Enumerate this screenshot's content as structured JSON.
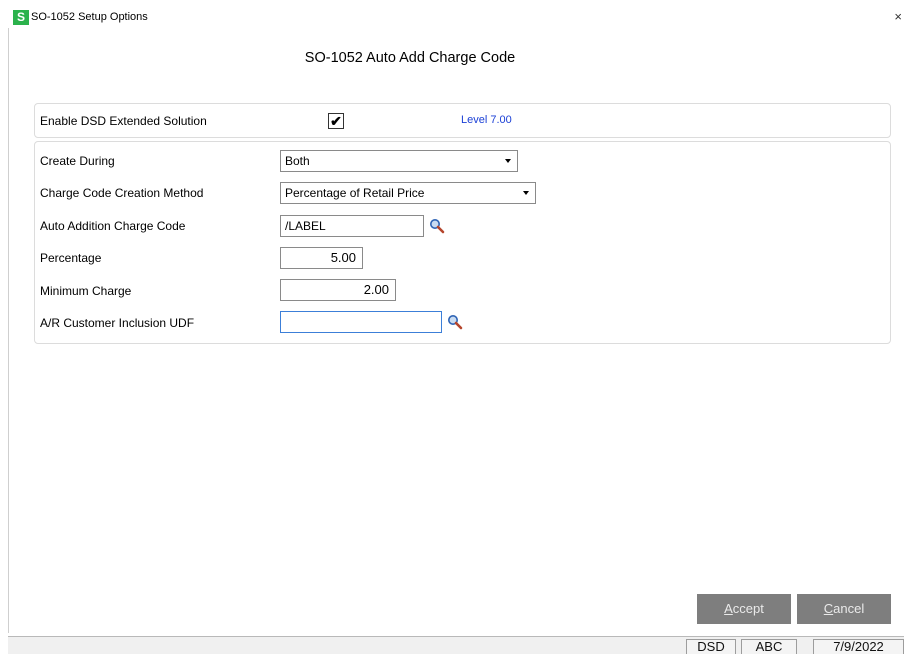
{
  "window": {
    "app_icon_letter": "S",
    "title": "SO-1052 Setup Options",
    "close_glyph": "×"
  },
  "dialog": {
    "heading": "SO-1052 Auto Add Charge Code"
  },
  "enable_panel": {
    "label": "Enable DSD Extended Solution",
    "checked": true,
    "check_glyph": "✔",
    "level": "Level 7.00"
  },
  "form": {
    "create_during": {
      "label": "Create During",
      "value": "Both"
    },
    "method": {
      "label": "Charge Code Creation Method",
      "value": "Percentage of Retail Price"
    },
    "charge_code": {
      "label": "Auto Addition Charge Code",
      "value": "/LABEL"
    },
    "percentage": {
      "label": "Percentage",
      "value": "5.00"
    },
    "minimum": {
      "label": "Minimum Charge",
      "value": "2.00"
    },
    "udf": {
      "label": "A/R Customer Inclusion UDF",
      "value": ""
    }
  },
  "buttons": {
    "accept_mnemonic": "A",
    "accept_rest": "ccept",
    "cancel_mnemonic": "C",
    "cancel_rest": "ancel"
  },
  "status": {
    "module": "DSD",
    "company": "ABC",
    "date": "7/9/2022"
  },
  "colors": {
    "level_text": "#1a3fd6",
    "icon_green": "#2bb24c",
    "button_bg": "#7e7e7e"
  }
}
